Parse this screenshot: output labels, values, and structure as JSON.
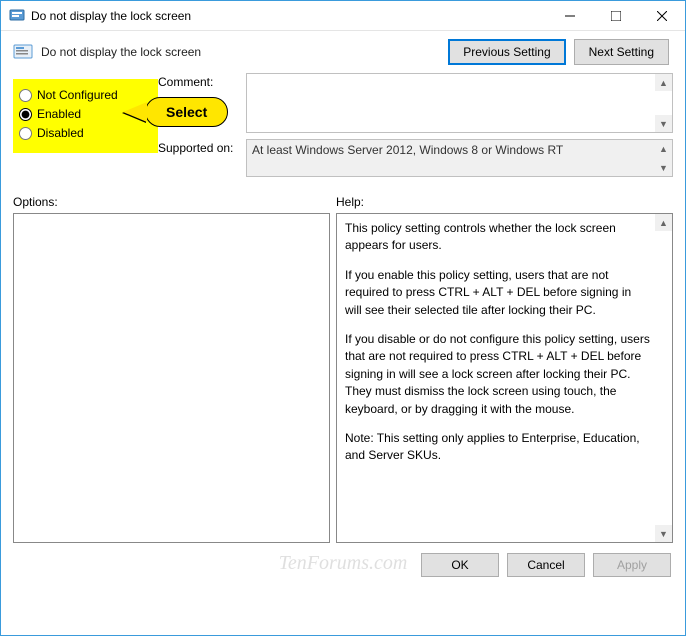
{
  "window": {
    "title": "Do not display the lock screen"
  },
  "header": {
    "subtitle": "Do not display the lock screen",
    "prev_btn": "Previous Setting",
    "next_btn": "Next Setting"
  },
  "radios": {
    "not_configured": "Not Configured",
    "enabled": "Enabled",
    "disabled": "Disabled",
    "selected": "enabled"
  },
  "callout": {
    "text": "Select"
  },
  "comment": {
    "label": "Comment:",
    "value": ""
  },
  "supported": {
    "label": "Supported on:",
    "value": "At least Windows Server 2012, Windows 8 or Windows RT"
  },
  "labels": {
    "options": "Options:",
    "help": "Help:"
  },
  "help": {
    "p1": "This policy setting controls whether the lock screen appears for users.",
    "p2": "If you enable this policy setting, users that are not required to press CTRL + ALT + DEL before signing in will see their selected tile after locking their PC.",
    "p3": "If you disable or do not configure this policy setting, users that are not required to press CTRL + ALT + DEL before signing in will see a lock screen after locking their PC. They must dismiss the lock screen using touch, the keyboard, or by dragging it with the mouse.",
    "p4": "Note: This setting only applies to Enterprise, Education, and Server SKUs."
  },
  "footer": {
    "ok": "OK",
    "cancel": "Cancel",
    "apply": "Apply"
  },
  "watermark": "TenForums.com"
}
